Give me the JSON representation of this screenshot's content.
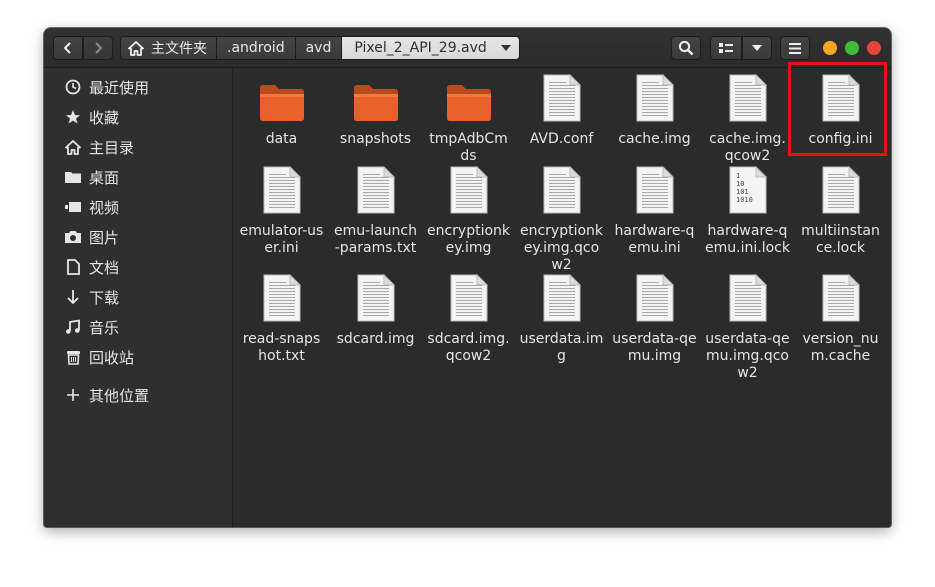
{
  "header": {
    "breadcrumb": [
      {
        "label": "主文件夹",
        "icon": "home-icon"
      },
      {
        "label": ".android"
      },
      {
        "label": "avd"
      },
      {
        "label": "Pixel_2_API_29.avd"
      }
    ],
    "icons": {
      "back": "chevron-left-icon",
      "forward": "chevron-right-icon",
      "search": "search-icon",
      "view": "grid-view-icon",
      "view_menu": "chevron-down-icon",
      "menu": "hamburger-menu-icon"
    },
    "window_controls": {
      "minimize_color": "#f4a624",
      "maximize_color": "#3fbb3a",
      "close_color": "#e8453c"
    }
  },
  "sidebar": {
    "items": [
      {
        "label": "最近使用",
        "icon": "clock-icon"
      },
      {
        "label": "收藏",
        "icon": "star-icon"
      },
      {
        "label": "主目录",
        "icon": "home-icon"
      },
      {
        "label": "桌面",
        "icon": "folder-icon"
      },
      {
        "label": "视频",
        "icon": "video-icon"
      },
      {
        "label": "图片",
        "icon": "camera-icon"
      },
      {
        "label": "文档",
        "icon": "document-icon"
      },
      {
        "label": "下载",
        "icon": "download-arrow-icon"
      },
      {
        "label": "音乐",
        "icon": "music-note-icon"
      },
      {
        "label": "回收站",
        "icon": "trash-icon"
      },
      {
        "label": "其他位置",
        "icon": "plus-icon"
      }
    ]
  },
  "files": [
    {
      "name": "data",
      "type": "folder"
    },
    {
      "name": "snapshots",
      "type": "folder"
    },
    {
      "name": "tmpAdbCmds",
      "type": "folder"
    },
    {
      "name": "AVD.conf",
      "type": "text"
    },
    {
      "name": "cache.img",
      "type": "text"
    },
    {
      "name": "cache.img.qcow2",
      "type": "text"
    },
    {
      "name": "config.ini",
      "type": "text"
    },
    {
      "name": "emulator-user.ini",
      "type": "text"
    },
    {
      "name": "emu-launch-params.txt",
      "type": "text"
    },
    {
      "name": "encryptionkey.img",
      "type": "text"
    },
    {
      "name": "encryptionkey.img.qcow2",
      "type": "text"
    },
    {
      "name": "hardware-qemu.ini",
      "type": "text"
    },
    {
      "name": "hardware-qemu.ini.lock",
      "type": "binary"
    },
    {
      "name": "multiinstance.lock",
      "type": "text"
    },
    {
      "name": "read-snapshot.txt",
      "type": "text"
    },
    {
      "name": "sdcard.img",
      "type": "text"
    },
    {
      "name": "sdcard.img.qcow2",
      "type": "text"
    },
    {
      "name": "userdata.img",
      "type": "text"
    },
    {
      "name": "userdata-qemu.img",
      "type": "text"
    },
    {
      "name": "userdata-qemu.img.qcow2",
      "type": "text"
    },
    {
      "name": "version_num.cache",
      "type": "text"
    }
  ],
  "binary_icon_text": [
    "1",
    "10",
    "101",
    "1010"
  ],
  "colors": {
    "folder_orange": "#e8612b",
    "highlight_red": "#e8100e",
    "text": "#e6e6e6"
  }
}
